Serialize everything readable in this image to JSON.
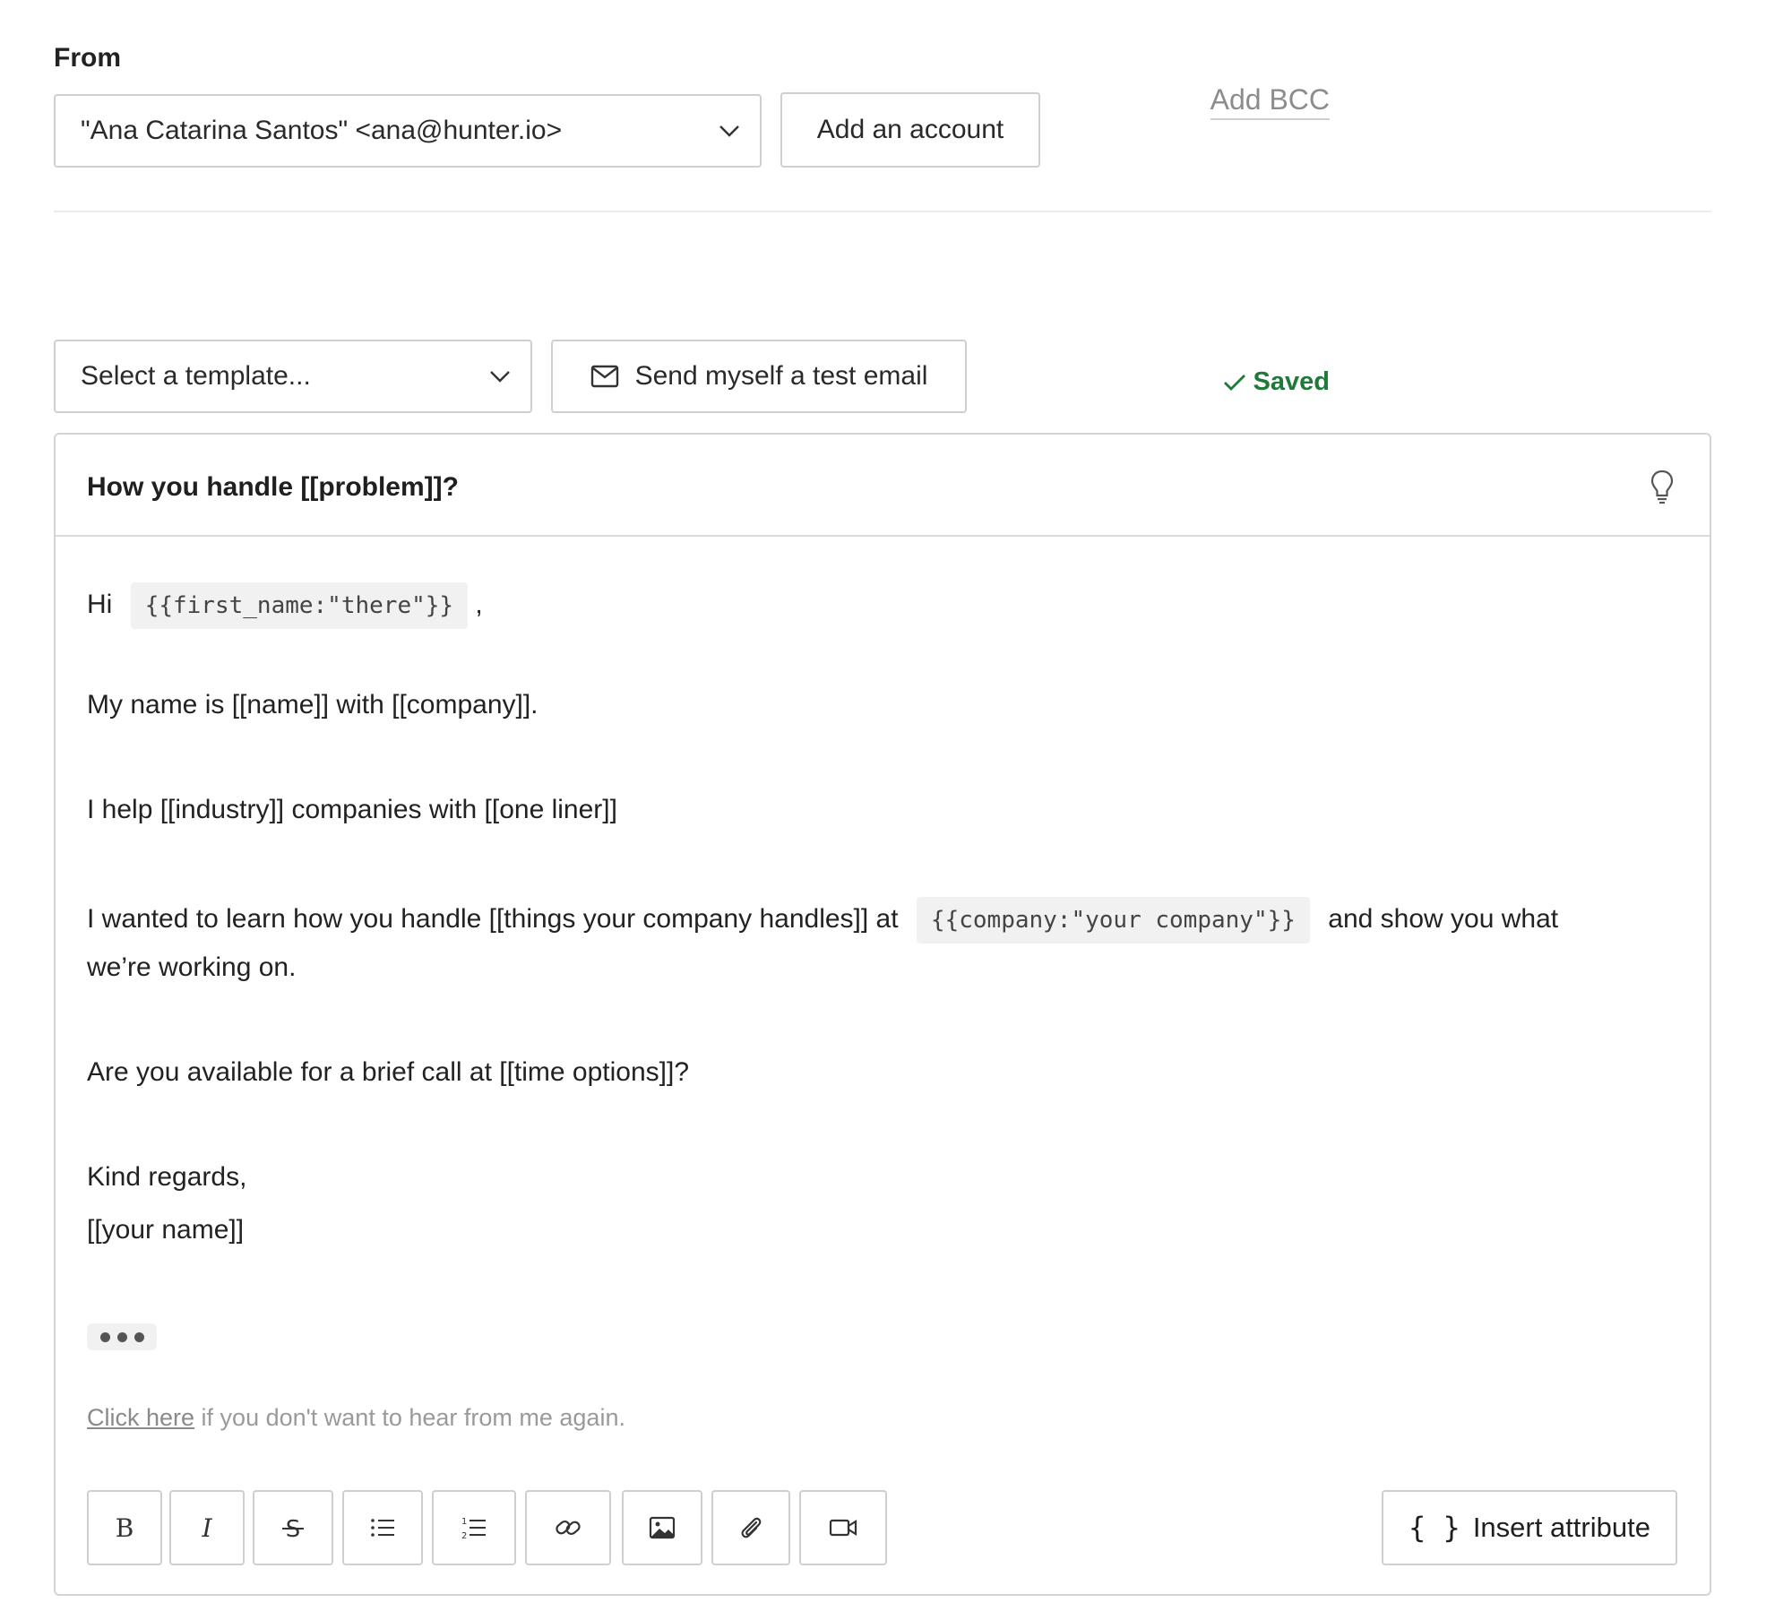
{
  "from": {
    "label": "From",
    "selected_account": "\"Ana Catarina Santos\" <ana@hunter.io>",
    "add_account_label": "Add an account",
    "add_bcc_label": "Add BCC"
  },
  "template": {
    "placeholder": "Select a template...",
    "test_email_label": "Send myself a test email",
    "status": "Saved",
    "status_color": "#1f7a3a"
  },
  "editor": {
    "subject": "How you handle [[problem]]?",
    "greeting_prefix": "Hi",
    "greeting_attr": "{{first_name:\"there\"}}",
    "greeting_suffix": ",",
    "line1": "My name is [[name]] with [[company]].",
    "line2": "I help [[industry]] companies with [[one liner]]",
    "line3_prefix": "I wanted to learn how you handle [[things your company handles]] at",
    "line3_attr": "{{company:\"your company\"}}",
    "line3_suffix": "and show you what",
    "line3_cont": "we’re working on.",
    "line4": "Are you available for a brief call at [[time options]]?",
    "signoff": "Kind regards,",
    "signature": "[[your name]]",
    "unsubscribe_link": "Click here",
    "unsubscribe_text": " if you don't want to hear from me again."
  },
  "toolbar": {
    "icons": [
      "bold-icon",
      "italic-icon",
      "strikethrough-icon",
      "bullet-list-icon",
      "numbered-list-icon",
      "link-icon",
      "image-icon",
      "attachment-icon",
      "video-icon"
    ],
    "insert_attribute_brace": "{ }",
    "insert_attribute_label": "Insert attribute"
  }
}
